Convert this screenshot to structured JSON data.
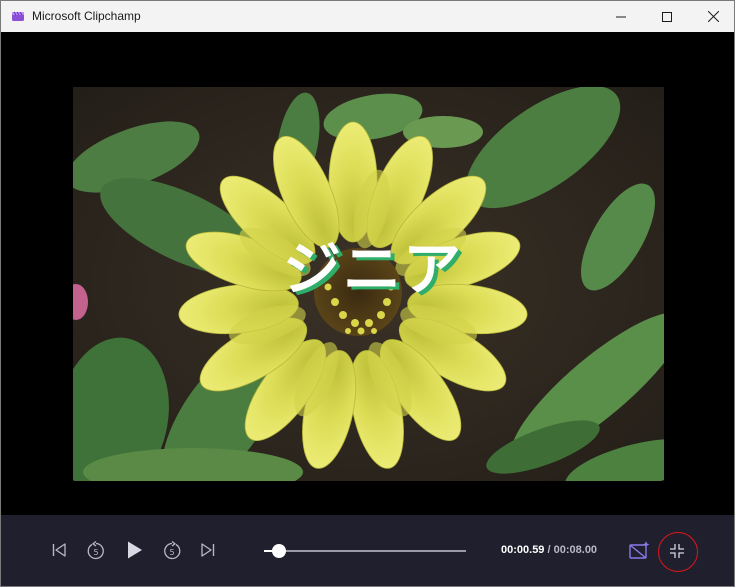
{
  "window": {
    "title": "Microsoft Clipchamp",
    "icon": "clipchamp-icon",
    "controls": [
      "minimize-icon",
      "maximize-icon",
      "close-icon"
    ]
  },
  "preview": {
    "caption": "ジニア"
  },
  "player": {
    "current_time": "00:00.59",
    "separator": "/",
    "total_time": "00:08.00",
    "progress_fraction": 0.074,
    "buttons": [
      "skip-to-start-icon",
      "rewind-5-seconds-icon",
      "play-icon",
      "forward-5-seconds-icon",
      "skip-to-end-icon",
      "effects-icon",
      "exit-fullscreen-icon"
    ]
  },
  "colors": {
    "titlebar": "#f3f3f3",
    "controls_bar": "#1f1f2e",
    "caption_shadow": "#2fae6a",
    "highlight": "#e0161b"
  }
}
